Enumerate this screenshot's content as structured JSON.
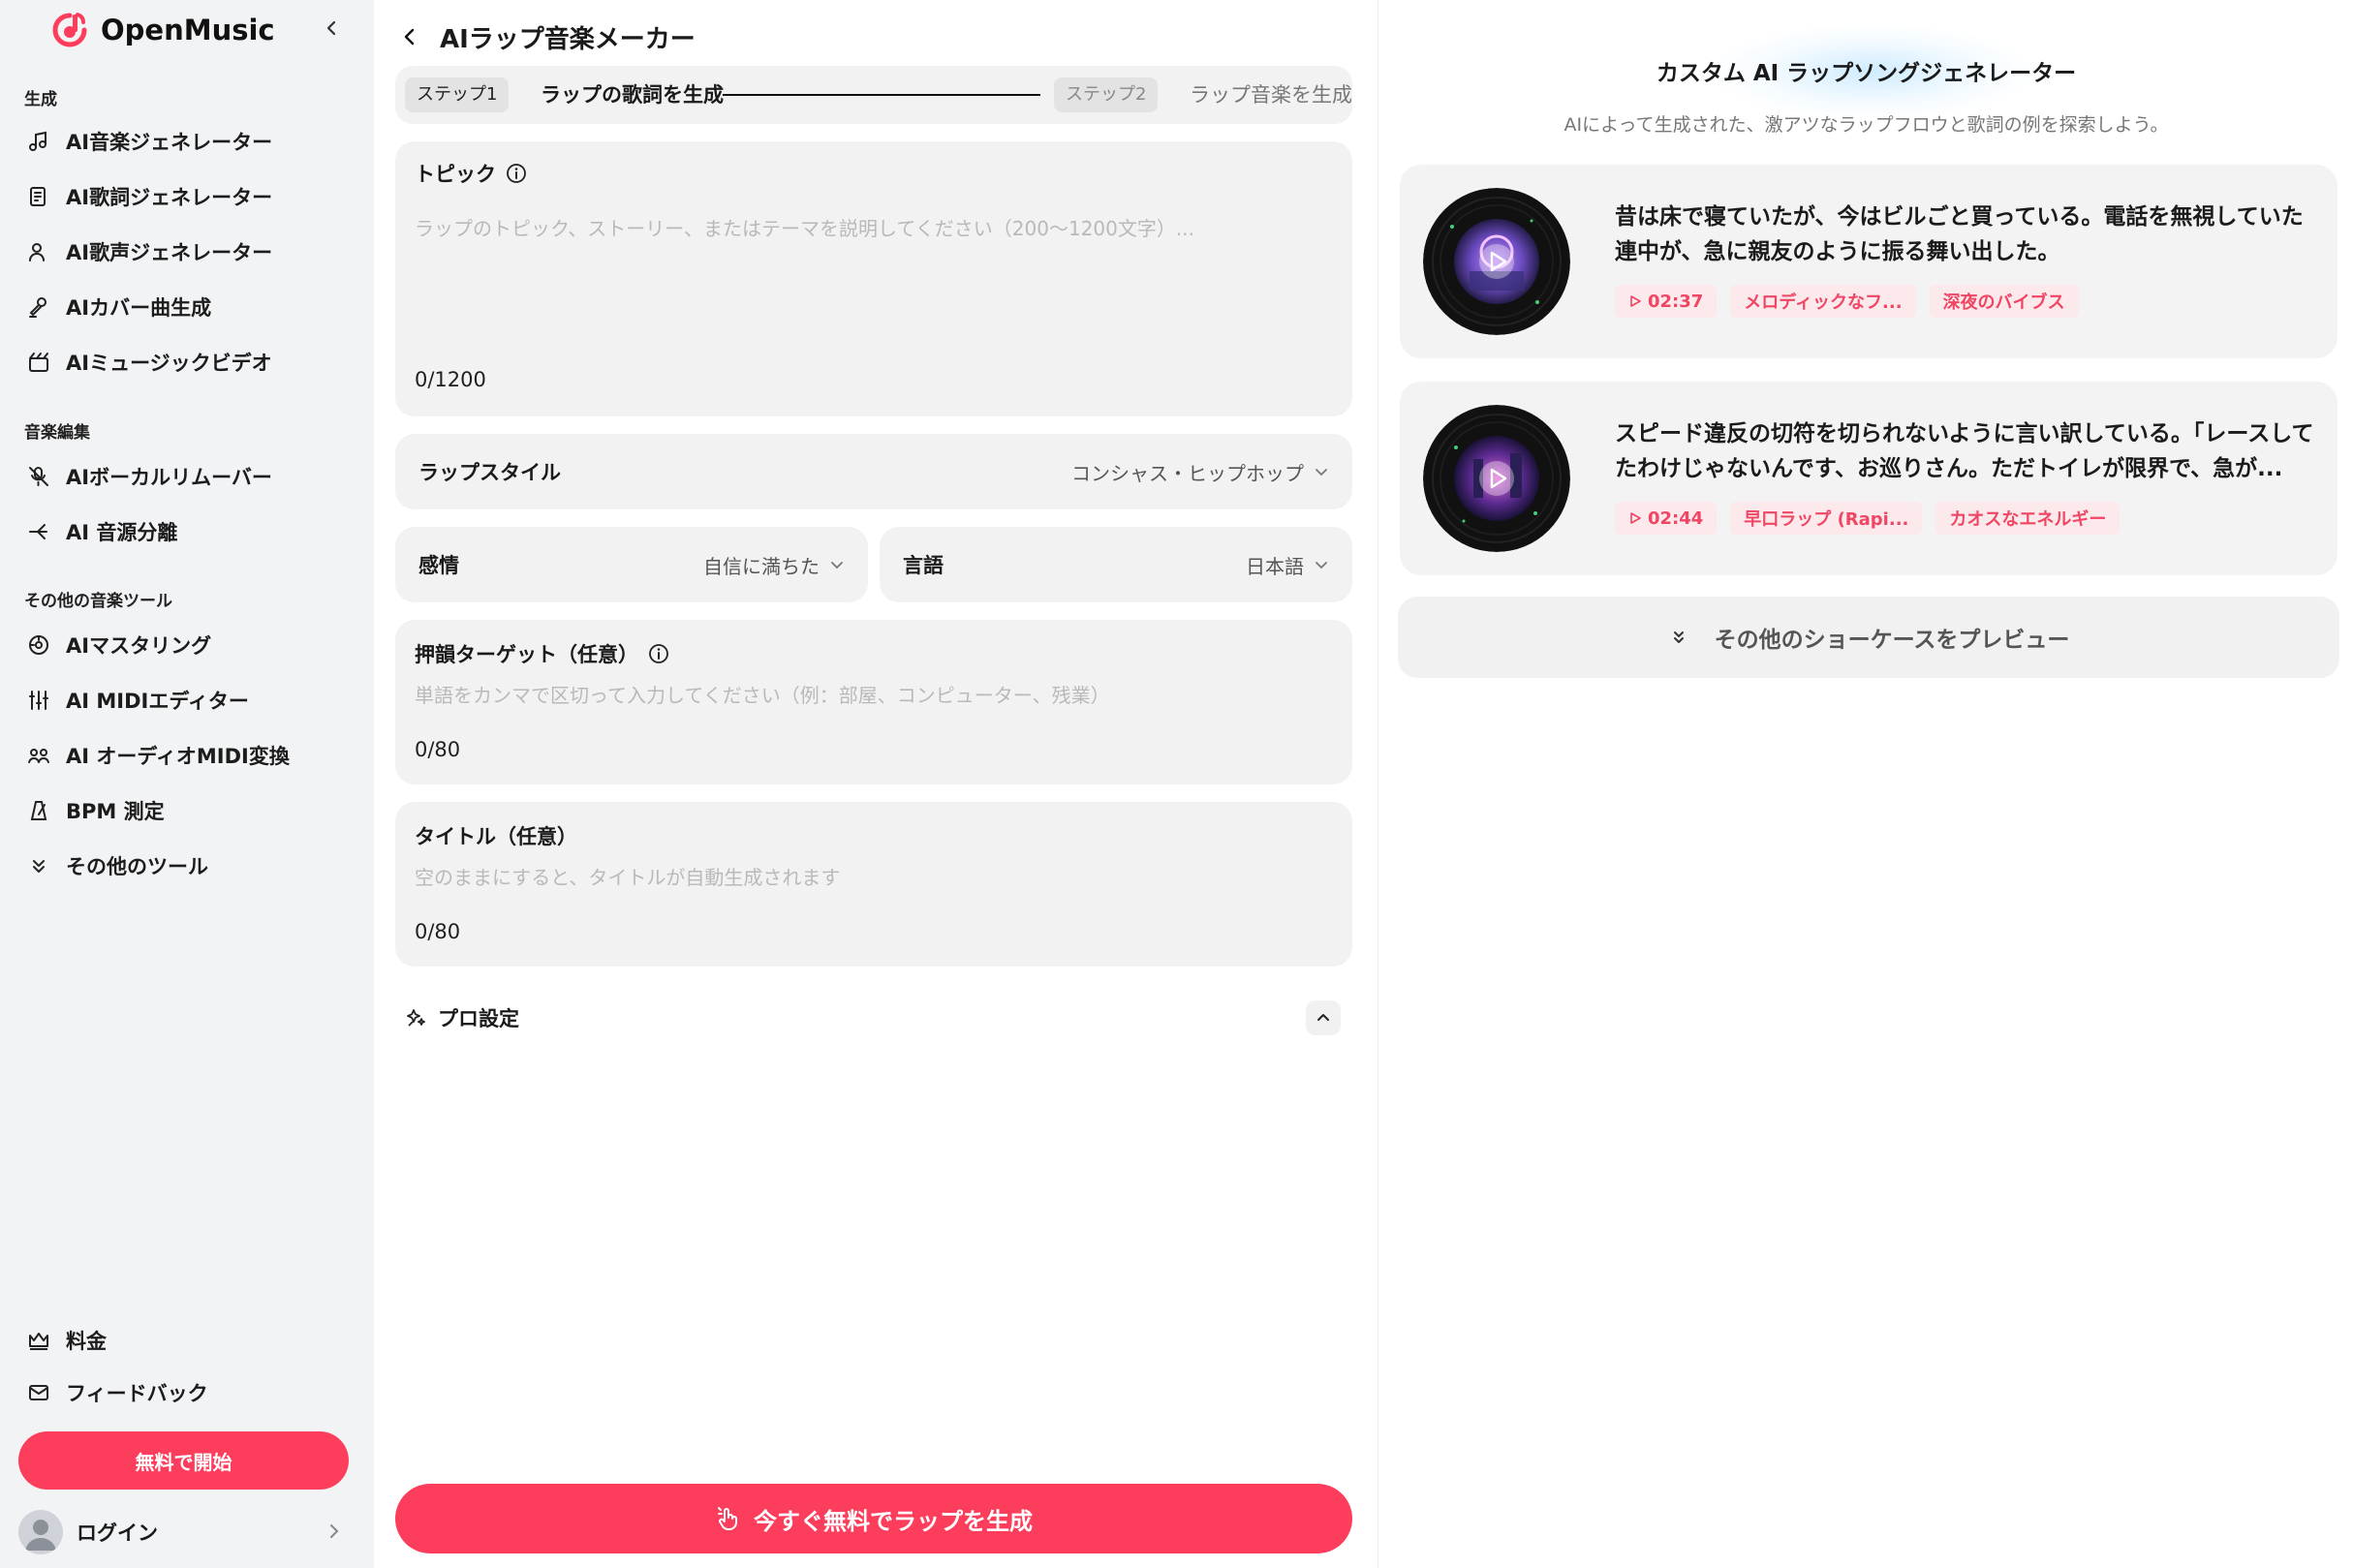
{
  "brand": {
    "name": "OpenMusic",
    "accent": "#fc3d5c"
  },
  "sidebar": {
    "sections": {
      "generate": "生成",
      "edit": "音楽編集",
      "other": "その他の音楽ツール"
    },
    "items": [
      {
        "label": "AI音楽ジェネレーター",
        "icon": "music-note-icon"
      },
      {
        "label": "AI歌詞ジェネレーター",
        "icon": "lyrics-icon"
      },
      {
        "label": "AI歌声ジェネレーター",
        "icon": "voice-icon"
      },
      {
        "label": "AIカバー曲生成",
        "icon": "cover-icon"
      },
      {
        "label": "AIミュージックビデオ",
        "icon": "video-icon"
      },
      {
        "label": "AIボーカルリムーバー",
        "icon": "vocal-remover-icon"
      },
      {
        "label": "AI 音源分離",
        "icon": "stem-split-icon"
      },
      {
        "label": "AIマスタリング",
        "icon": "mastering-icon"
      },
      {
        "label": "AI MIDIエディター",
        "icon": "midi-icon"
      },
      {
        "label": "AI オーディオMIDI変換",
        "icon": "audio-midi-icon"
      },
      {
        "label": "BPM 測定",
        "icon": "metronome-icon"
      },
      {
        "label": "その他のツール",
        "icon": "chevrons-down-icon"
      }
    ],
    "pricing": "料金",
    "feedback": "フィードバック",
    "start_free": "無料で開始",
    "login": "ログイン"
  },
  "form": {
    "title": "AIラップ音楽メーカー",
    "step1_badge": "ステップ1",
    "step1_label": "ラップの歌詞を生成",
    "step2_badge": "ステップ2",
    "step2_label": "ラップ音楽を生成",
    "topic_label": "トピック",
    "topic_placeholder": "ラップのトピック、ストーリー、またはテーマを説明してください（200〜1200文字）...",
    "topic_counter": "0/1200",
    "style_label": "ラップスタイル",
    "style_value": "コンシャス・ヒップホップ",
    "emotion_label": "感情",
    "emotion_value": "自信に満ちた",
    "language_label": "言語",
    "language_value": "日本語",
    "rhyme_label": "押韻ターゲット（任意）",
    "rhyme_placeholder": "単語をカンマで区切って入力してください（例：部屋、コンピューター、残業）",
    "rhyme_counter": "0/80",
    "title_label": "タイトル（任意）",
    "title_placeholder": "空のままにすると、タイトルが自動生成されます",
    "title_counter": "0/80",
    "pro_settings": "プロ設定",
    "generate_button": "今すぐ無料でラップを生成"
  },
  "showcase": {
    "title": "カスタム AI ラップソングジェネレーター",
    "subtitle": "AIによって生成された、激アツなラップフロウと歌詞の例を探索しよう。",
    "songs": [
      {
        "title": "昔は床で寝ていたが、今はビルごと買っている。電話を無視していた連中が、急に親友のように振る舞い出した。",
        "duration": "02:37",
        "tag1": "メロディックなフ...",
        "tag2": "深夜のバイブス"
      },
      {
        "title": "スピード違反の切符を切られないように言い訳している。「レースしてたわけじゃないんです、お巡りさん。ただトイレが限界で、急が...",
        "duration": "02:44",
        "tag1": "早口ラップ (Rapi...",
        "tag2": "カオスなエネルギー"
      }
    ],
    "preview_more": "その他のショーケースをプレビュー"
  }
}
